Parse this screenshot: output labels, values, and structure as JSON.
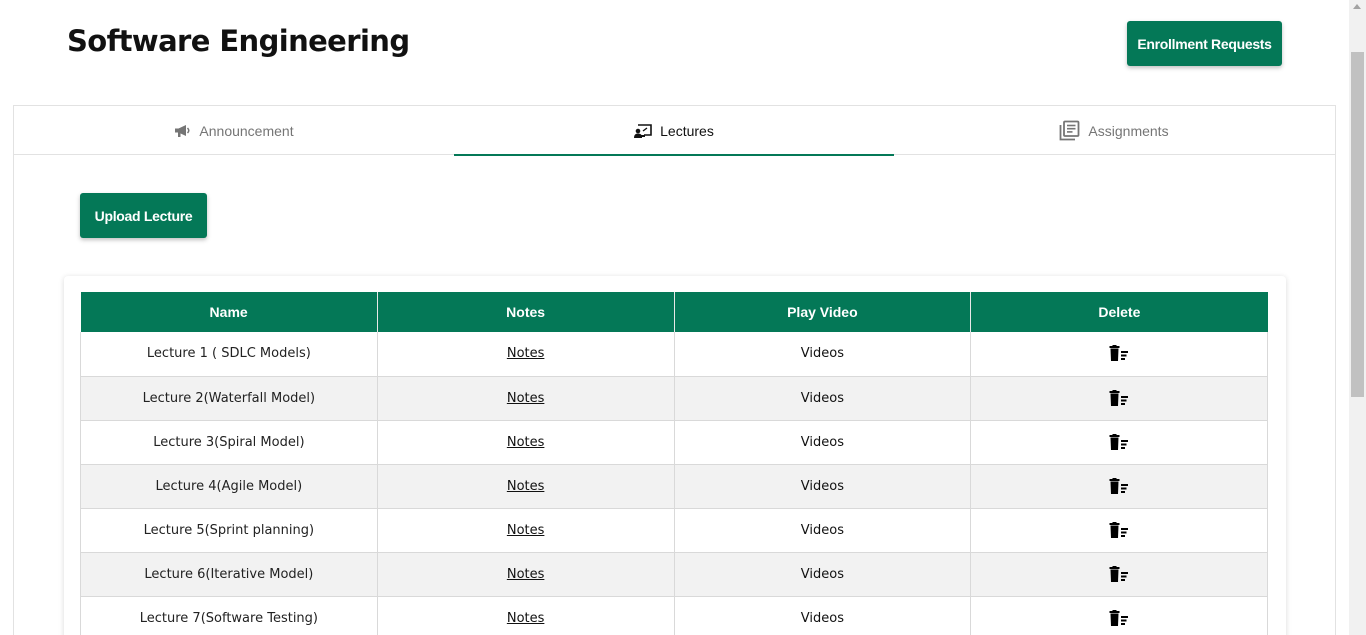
{
  "header": {
    "title": "Software Engineering",
    "enrollment_button": "Enrollment Requests"
  },
  "tabs": [
    {
      "label": "Announcement",
      "icon": "megaphone-icon",
      "active": false
    },
    {
      "label": "Lectures",
      "icon": "teacher-board-icon",
      "active": true
    },
    {
      "label": "Assignments",
      "icon": "library-books-icon",
      "active": false
    }
  ],
  "upload_button": "Upload Lecture",
  "table": {
    "columns": [
      "Name",
      "Notes",
      "Play Video",
      "Delete"
    ],
    "rows": [
      {
        "name": "Lecture 1 ( SDLC Models)",
        "notes": "Notes",
        "video": "Videos"
      },
      {
        "name": "Lecture 2(Waterfall Model)",
        "notes": "Notes",
        "video": "Videos"
      },
      {
        "name": "Lecture 3(Spiral Model)",
        "notes": "Notes",
        "video": "Videos"
      },
      {
        "name": "Lecture 4(Agile Model)",
        "notes": "Notes",
        "video": "Videos"
      },
      {
        "name": "Lecture 5(Sprint planning)",
        "notes": "Notes",
        "video": "Videos"
      },
      {
        "name": "Lecture 6(Iterative Model)",
        "notes": "Notes",
        "video": "Videos"
      },
      {
        "name": "Lecture 7(Software Testing)",
        "notes": "Notes",
        "video": "Videos"
      }
    ]
  },
  "colors": {
    "accent": "#047857",
    "row_alt": "#f2f2f2"
  }
}
